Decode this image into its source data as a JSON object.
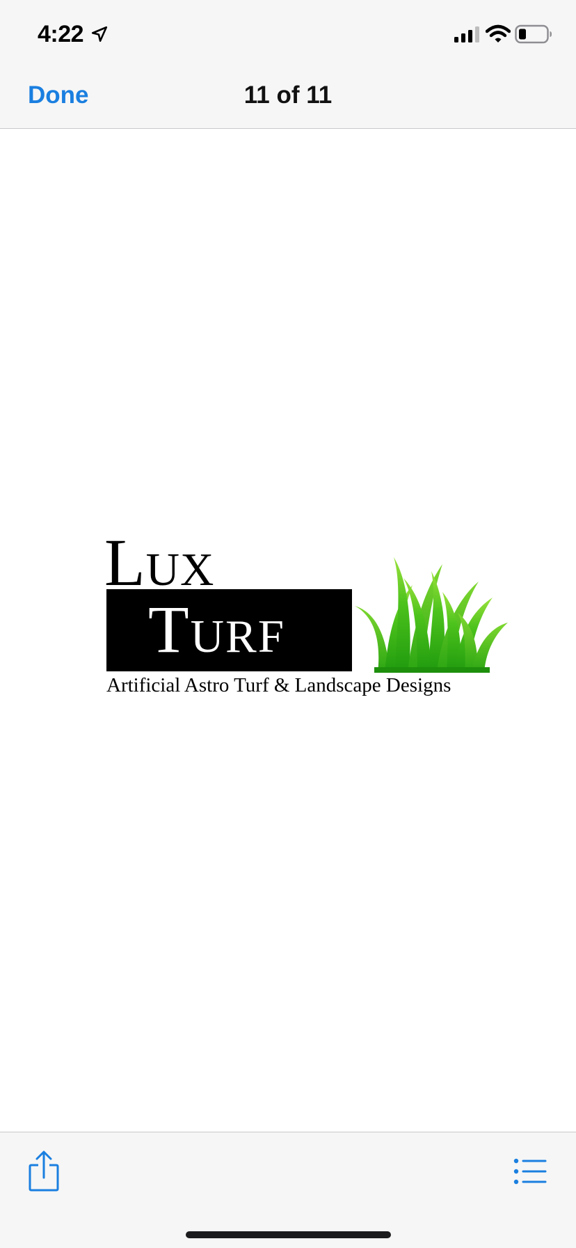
{
  "status_bar": {
    "time": "4:22",
    "icons": [
      "location-arrow-icon",
      "cellular-signal-icon",
      "wifi-icon",
      "battery-icon"
    ]
  },
  "nav_bar": {
    "done_label": "Done",
    "page_counter": "11 of 11"
  },
  "document": {
    "logo": {
      "line1": "Lux",
      "line2": "Turf",
      "tagline": "Artificial Astro Turf & Landscape Designs"
    }
  },
  "toolbar": {
    "icons": [
      "share-icon",
      "list-icon"
    ]
  },
  "colors": {
    "accent": "#1a7fe0",
    "bar_background": "#f6f6f6",
    "grass_green": "#3cb81a"
  }
}
